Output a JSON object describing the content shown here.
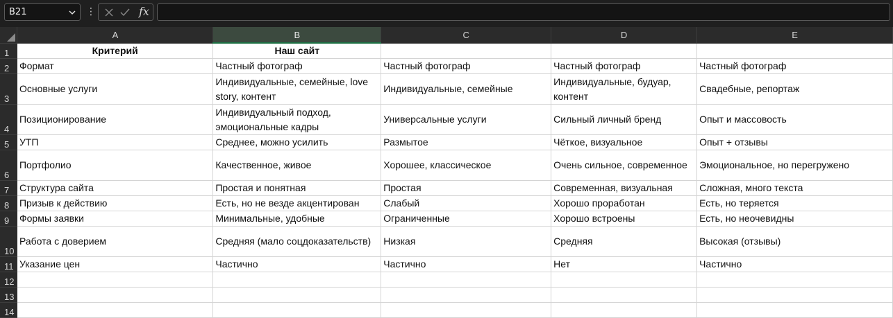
{
  "formula_bar": {
    "name_box": "B21",
    "fx_label": "fx",
    "formula_value": ""
  },
  "columns": [
    "A",
    "B",
    "C",
    "D",
    "E"
  ],
  "selected_column": "B",
  "row_numbers": [
    "1",
    "2",
    "3",
    "4",
    "5",
    "6",
    "7",
    "8",
    "9",
    "10",
    "11",
    "12",
    "13",
    "14"
  ],
  "header_row": [
    "Критерий",
    "Наш сайт",
    "",
    "",
    ""
  ],
  "rows": [
    [
      "Формат",
      "Частный фотограф",
      "Частный фотограф",
      "Частный фотограф",
      "Частный фотограф"
    ],
    [
      "Основные услуги",
      "Индивидуальные, семейные, love story, контент",
      "Индивидуальные, семейные",
      "Индивидуальные, будуар, контент",
      "Свадебные, репортаж"
    ],
    [
      "Позиционирование",
      "Индивидуальный подход, эмоциональные кадры",
      "Универсальные услуги",
      "Сильный личный бренд",
      "Опыт и массовость"
    ],
    [
      "УТП",
      "Среднее, можно усилить",
      "Размытое",
      "Чёткое, визуальное",
      "Опыт + отзывы"
    ],
    [
      "Портфолио",
      "Качественное, живое",
      "Хорошее, классическое",
      "Очень сильное, современное",
      "Эмоциональное, но перегружено"
    ],
    [
      "Структура сайта",
      "Простая и понятная",
      "Простая",
      "Современная, визуальная",
      "Сложная, много текста"
    ],
    [
      "Призыв к действию",
      "Есть, но не везде акцентирован",
      "Слабый",
      "Хорошо проработан",
      "Есть, но теряется"
    ],
    [
      "Формы заявки",
      "Минимальные, удобные",
      "Ограниченные",
      "Хорошо встроены",
      "Есть, но неочевидны"
    ],
    [
      "Работа с доверием",
      "Средняя (мало соцдоказательств)",
      "Низкая",
      "Средняя",
      "Высокая (отзывы)"
    ],
    [
      "Указание цен",
      "Частично",
      "Частично",
      "Нет",
      "Частично"
    ],
    [
      "",
      "",
      "",
      "",
      ""
    ],
    [
      "",
      "",
      "",
      "",
      ""
    ],
    [
      "",
      "",
      "",
      "",
      ""
    ]
  ],
  "colors": {
    "selected_header_accent": "#1e7145",
    "redaction": "#ff1a1a"
  }
}
